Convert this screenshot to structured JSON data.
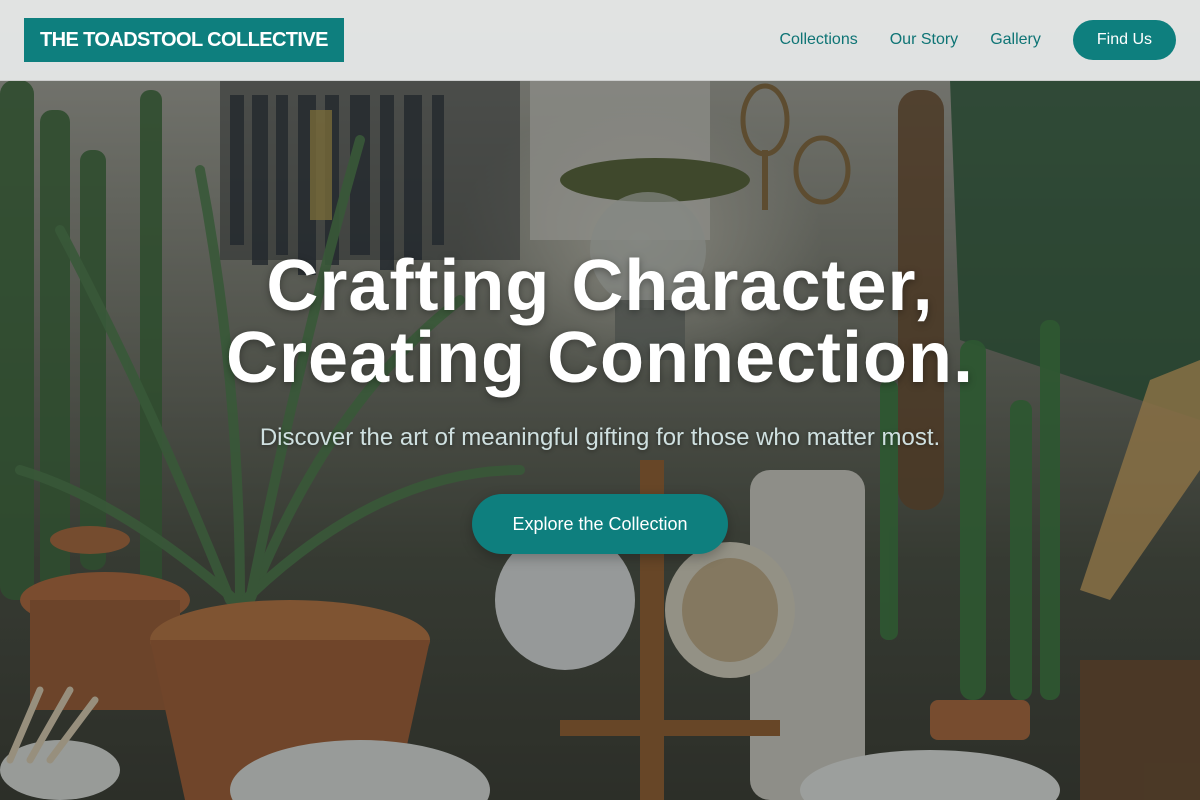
{
  "header": {
    "logo": "THE TOADSTOOL COLLECTIVE",
    "nav": {
      "collections": "Collections",
      "our_story": "Our Story",
      "gallery": "Gallery",
      "find_us": "Find Us"
    }
  },
  "hero": {
    "headline_line1": "Crafting Character,",
    "headline_line2": "Creating Connection.",
    "subheadline": "Discover the art of meaningful gifting for those who matter most.",
    "cta": "Explore the Collection",
    "background_description_icon": "shop-interior-photo"
  },
  "colors": {
    "brand": "#0e7f7e",
    "nav_text": "#0e7475",
    "header_bg": "#eceeee"
  }
}
